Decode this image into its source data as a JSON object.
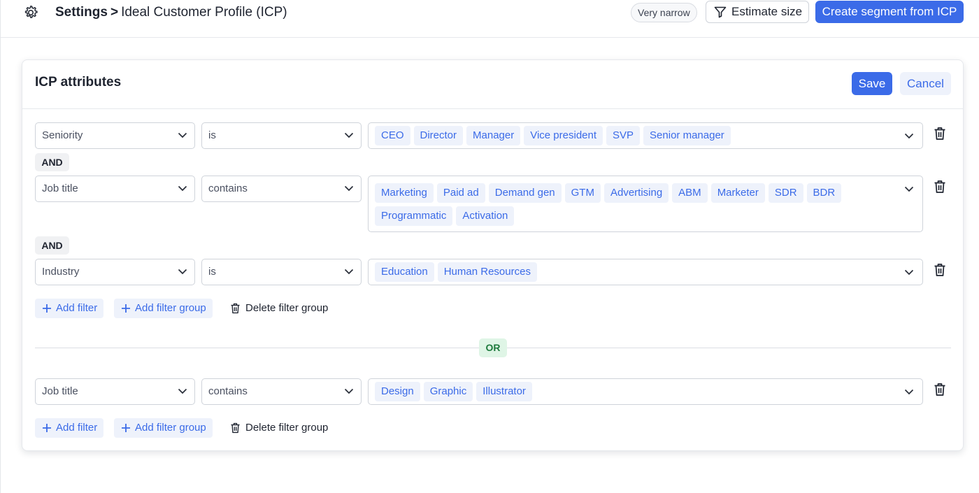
{
  "header": {
    "breadcrumb_root": "Settings",
    "breadcrumb_sep": ">",
    "breadcrumb_page": "Ideal Customer Profile (ICP)",
    "size_badge": "Very narrow",
    "estimate_label": "Estimate size",
    "create_label": "Create segment from ICP"
  },
  "card": {
    "title": "ICP attributes",
    "save_label": "Save",
    "cancel_label": "Cancel"
  },
  "groups": [
    {
      "filters": [
        {
          "attribute": "Seniority",
          "operator": "is",
          "values": [
            "CEO",
            "Director",
            "Manager",
            "Vice president",
            "SVP",
            "Senior manager"
          ]
        },
        {
          "attribute": "Job title",
          "operator": "contains",
          "values": [
            "Marketing",
            "Paid ad",
            "Demand gen",
            "GTM",
            "Advertising",
            "ABM",
            "Marketer",
            "SDR",
            "BDR",
            "Programmatic",
            "Activation"
          ]
        },
        {
          "attribute": "Industry",
          "operator": "is",
          "values": [
            "Education",
            "Human Resources"
          ]
        }
      ],
      "connector": "AND"
    },
    {
      "filters": [
        {
          "attribute": "Job title",
          "operator": "contains",
          "values": [
            "Design",
            "Graphic",
            "Illustrator"
          ]
        }
      ]
    }
  ],
  "group_connector": "OR",
  "actions": {
    "add_filter": "Add filter",
    "add_filter_group": "Add filter group",
    "delete_filter_group": "Delete filter group"
  },
  "colors": {
    "accent": "#3b6be8",
    "chip_bg": "#eef2fb",
    "or_bg": "#dff5e6",
    "or_text": "#1e7a3d"
  },
  "icons": {
    "settings": "gear-icon",
    "estimate": "filter-funnel-icon",
    "delete": "trash-icon",
    "add": "plus-icon",
    "dropdown": "chevron-down-icon"
  }
}
